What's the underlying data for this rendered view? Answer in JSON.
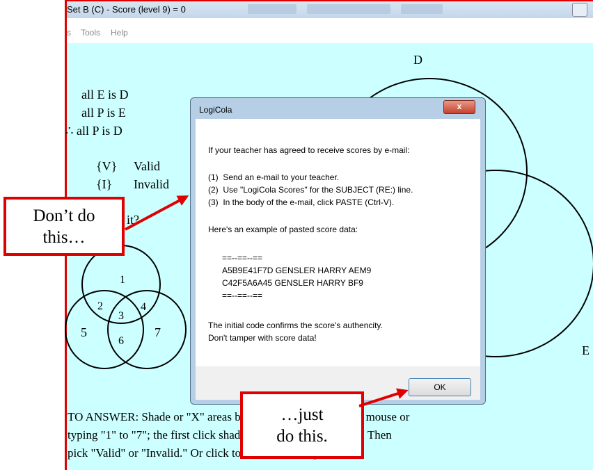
{
  "window": {
    "title": "Set B (C) - Score (level 9) = 0"
  },
  "menubar": {
    "items": [
      "s",
      "Tools",
      "Help"
    ]
  },
  "problem": {
    "premise1": "all E is D",
    "premise2": "all P is E",
    "conclusion": "∴ all P is D",
    "option_valid_key": "{V}",
    "option_valid_label": "Valid",
    "option_invalid_key": "{I}",
    "option_invalid_label": "Invalid",
    "question_fragment": "it?"
  },
  "venn_small": {
    "regions": [
      "1",
      "2",
      "3",
      "4",
      "5",
      "6",
      "7"
    ]
  },
  "venn_large": {
    "label_top": "D",
    "label_right": "E"
  },
  "instructions": {
    "line1": "TO ANSWER: Shade or \"X\" areas by clicking them with your mouse or",
    "line2": "typing \"1\" to \"7\"; the first click shades; the second inserts \"X.\" Then",
    "line3": "pick \"Valid\" or \"Invalid.\" Or click to draw Venn diagrams."
  },
  "dialog": {
    "title": "LogiCola",
    "close_glyph": "x",
    "lines": [
      "If your teacher has agreed to receive scores by e-mail:",
      "(1)  Send an e-mail to your teacher.",
      "(2)  Use \"LogiCola Scores\" for the SUBJECT (RE:) line.",
      "(3)  In the body of the e-mail, click PASTE (Ctrl-V).",
      "Here's an example of pasted score data:",
      "==--==--==",
      "A5B9E41F7D GENSLER HARRY AEM9",
      "C42F5A6A45 GENSLER HARRY BF9",
      "==--==--==",
      "The initial code confirms the score's authencity.",
      "Don't tamper with score data!"
    ],
    "ok_label": "OK"
  },
  "callouts": {
    "dont_line1": "Don’t do",
    "dont_line2": "this…",
    "do_line1": "…just",
    "do_line2": "do this."
  },
  "colors": {
    "background": "#ccffff",
    "annotation": "#e00000"
  }
}
